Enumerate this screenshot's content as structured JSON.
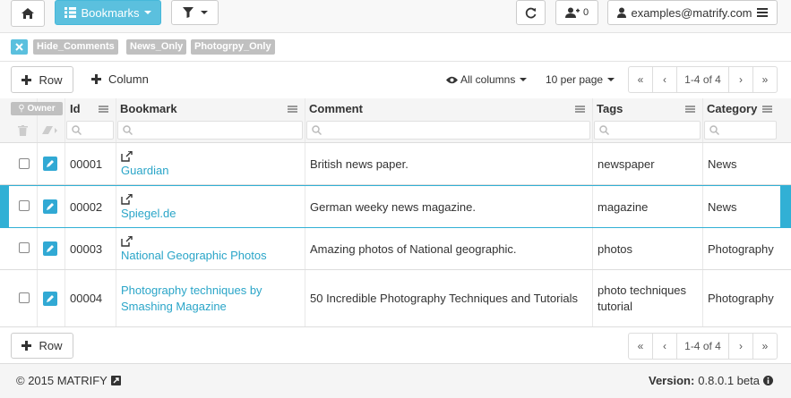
{
  "nav": {
    "bookmarks_label": "Bookmarks",
    "notifications_count": "0",
    "user_email": "examples@matrify.com"
  },
  "filters": {
    "tags": [
      "Hide_Comments",
      "News_Only",
      "Photogrpy_Only"
    ]
  },
  "toolbar": {
    "add_row_label": "Row",
    "add_column_label": "Column",
    "columns_label": "All columns",
    "per_page_label": "10 per page",
    "page_range": "1-4 of 4"
  },
  "table": {
    "owner_label": "Owner",
    "columns": [
      "Id",
      "Bookmark",
      "Comment",
      "Tags",
      "Category"
    ],
    "rows": [
      {
        "id": "00001",
        "bookmark": "Guardian",
        "bookmark2": "",
        "comment": "British news paper.",
        "tags": "newspaper",
        "tags2": "",
        "category": "News"
      },
      {
        "id": "00002",
        "bookmark": "Spiegel.de",
        "bookmark2": "",
        "comment": "German weeky news magazine.",
        "tags": "magazine",
        "tags2": "",
        "category": "News"
      },
      {
        "id": "00003",
        "bookmark": "National Geographic Photos",
        "bookmark2": "",
        "comment": "Amazing photos of National geographic.",
        "tags": "photos",
        "tags2": "",
        "category": "Photography"
      },
      {
        "id": "00004",
        "bookmark": "Photography techniques by",
        "bookmark2": "Smashing Magazine",
        "comment": "50 Incredible Photography Techniques and Tutorials",
        "tags": "photo techniques",
        "tags2": "tutorial",
        "category": "Photography"
      }
    ]
  },
  "bottom": {
    "add_row_label": "Row",
    "page_range": "1-4 of 4"
  },
  "footer": {
    "copyright": "© 2015 MATRIFY",
    "version_label": "Version:",
    "version_value": "0.8.0.1 beta"
  },
  "colors": {
    "accent": "#5bc0de",
    "link": "#2aa5c8",
    "selected_marker": "#31b0d5"
  }
}
